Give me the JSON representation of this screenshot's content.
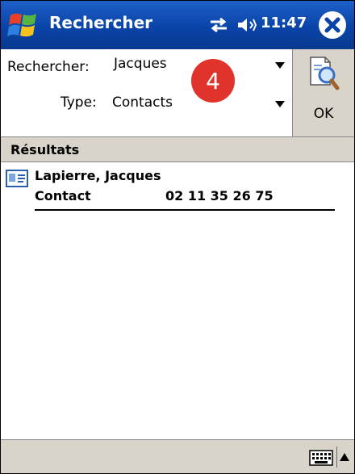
{
  "titlebar": {
    "title": "Rechercher",
    "time": "11:47",
    "icons": [
      "windows-start-icon",
      "connectivity-icon",
      "speaker-icon",
      "close-icon"
    ]
  },
  "search": {
    "query_label": "Rechercher:",
    "query_value": "Jacques",
    "type_label": "Type:",
    "type_value": "Contacts",
    "ok_label": "OK",
    "step_badge": "4"
  },
  "results": {
    "header": "Résultats",
    "items": [
      {
        "name": "Lapierre, Jacques",
        "type": "Contact",
        "phone": "02 11 35 26 75",
        "icon": "contact-card-icon"
      }
    ]
  },
  "colors": {
    "titlebar": "#0a44a8",
    "chrome": "#d9d4ca",
    "badge": "#e0332b"
  }
}
